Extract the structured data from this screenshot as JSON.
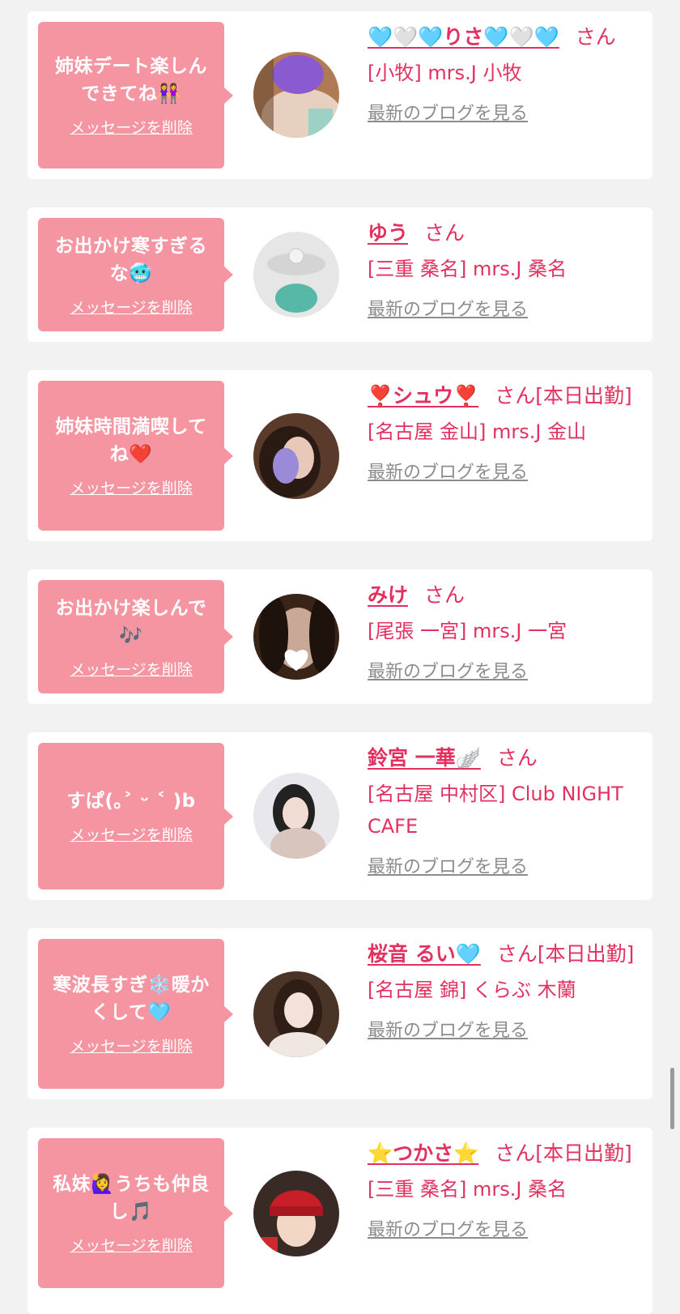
{
  "cards": [
    {
      "message": "姉妹デート楽しんできてね👭",
      "delete_label": "メッセージを削除",
      "name": "🩵🤍🩵りさ🩵🤍🩵",
      "suffix": "さん",
      "shop": "[小牧] mrs.J 小牧",
      "blog_label": "最新のブログを見る"
    },
    {
      "message": "お出かけ寒すぎるな🥶",
      "delete_label": "メッセージを削除",
      "name": "ゆう",
      "suffix": "さん",
      "shop": "[三重 桑名] mrs.J 桑名",
      "blog_label": "最新のブログを見る"
    },
    {
      "message": "姉妹時間満喫してね❤️",
      "delete_label": "メッセージを削除",
      "name": "❣️シュウ❣️",
      "suffix": "さん[本日出勤]",
      "shop": "[名古屋 金山] mrs.J 金山",
      "blog_label": "最新のブログを見る"
    },
    {
      "message": "お出かけ楽しんで🎶",
      "delete_label": "メッセージを削除",
      "name": "みけ",
      "suffix": "さん",
      "shop": "[尾張 一宮] mrs.J 一宮",
      "blog_label": "最新のブログを見る"
    },
    {
      "message": "すぱ(｡˃ ᵕ ˂ )b",
      "delete_label": "メッセージを削除",
      "name": "鈴宮 一華🪽",
      "suffix": "さん",
      "shop": "[名古屋 中村区] Club NIGHT CAFE",
      "blog_label": "最新のブログを見る"
    },
    {
      "message": "寒波長すぎ❄️暖かくして🩵",
      "delete_label": "メッセージを削除",
      "name": "桜音 るい🩵",
      "suffix": "さん[本日出勤]",
      "shop": "[名古屋 錦] くらぶ 木蘭",
      "blog_label": "最新のブログを見る"
    },
    {
      "message": "私妹🙋‍♀️うちも仲良し🎵",
      "delete_label": "メッセージを削除",
      "name": "⭐️つかさ⭐️",
      "suffix": "さん[本日出勤]",
      "shop": "[三重 桑名] mrs.J 桑名",
      "blog_label": "最新のブログを見る"
    }
  ]
}
